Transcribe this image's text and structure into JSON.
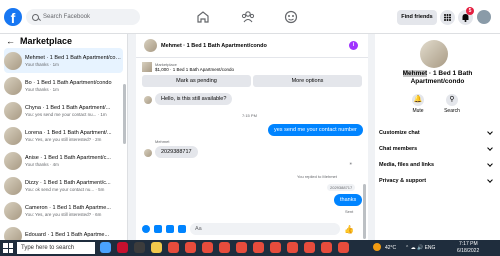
{
  "topbar": {
    "search_placeholder": "Search Facebook",
    "find_friends": "Find friends",
    "notif_count": "5"
  },
  "sidebar": {
    "title": "Marketplace",
    "conversations": [
      {
        "name": "Mehmet · 1 Bed 1 Bath Apartment/condo",
        "preview": "Your thanks · 1m",
        "active": true
      },
      {
        "name": "Bo · 1 Bed 1 Bath Apartment/condo",
        "preview": "Your thanks · 1m"
      },
      {
        "name": "Chyna · 1 Bed 1 Bath Apartment/...",
        "preview": "You: yes send me your contact nu... · 1m"
      },
      {
        "name": "Lorena · 1 Bed 1 Bath Apartment/...",
        "preview": "You: Yes, are you still interested? · 2m"
      },
      {
        "name": "Anise · 1 Bed 1 Bath Apartment/c...",
        "preview": "Your thanks · 4m"
      },
      {
        "name": "Dizzy · 1 Bed 1 Bath Apartment/c...",
        "preview": "You: ok send me your contact nu... · 5m"
      },
      {
        "name": "Cameron · 1 Bed 1 Bath Apartme...",
        "preview": "You: Yes, are you still interested? · 6m"
      },
      {
        "name": "Edouard · 1 Bed 1 Bath Apartme...",
        "preview": ""
      }
    ]
  },
  "chat": {
    "title": "Mehmet · 1 Bed 1 Bath Apartment/condo",
    "listing_label": "Marketplace",
    "listing_sub": "$1,000 · 1 Bed 1 Bath Apartment/condo",
    "mark_pending": "Mark as pending",
    "more_options": "More options",
    "msg_in_1": "Hello, is this still available?",
    "time_1": "7:15 PM",
    "msg_out_1": "yes send me your contact number",
    "sender_name": "Mehmet",
    "msg_in_2": "2029388717",
    "replied_label": "You replied to Mehmet",
    "replied_quote": "2029388717",
    "msg_out_2": "thanks",
    "sent_label": "Sent",
    "composer_placeholder": "Aa"
  },
  "info": {
    "title_highlight": "Mehmet",
    "title_rest": " · 1 Bed 1 Bath Apartment/condo",
    "mute": "Mute",
    "search": "Search",
    "rows": [
      "Customize chat",
      "Chat members",
      "Media, files and links",
      "Privacy & support"
    ]
  },
  "taskbar": {
    "search_placeholder": "Type here to search",
    "weather": "42°C",
    "time": "7:17 PM",
    "date": "6/18/2022"
  },
  "colors": {
    "brand": "#1877f2",
    "messenger": "#0084ff",
    "badge": "#e41e3f"
  }
}
